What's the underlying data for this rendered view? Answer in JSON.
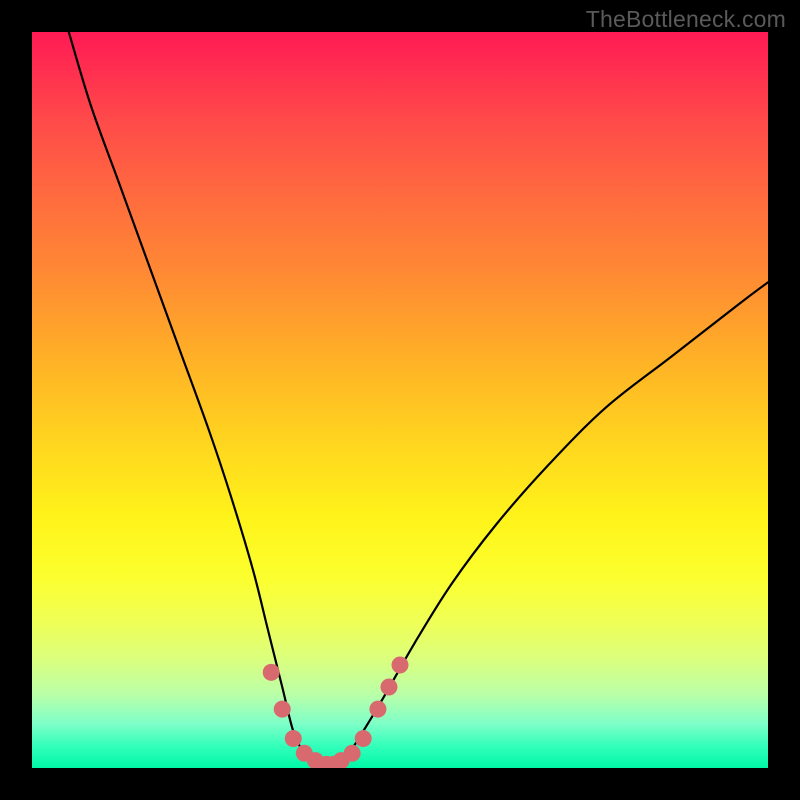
{
  "watermark": "TheBottleneck.com",
  "chart_data": {
    "type": "line",
    "title": "",
    "xlabel": "",
    "ylabel": "",
    "xlim": [
      0,
      100
    ],
    "ylim": [
      0,
      100
    ],
    "series": [
      {
        "name": "curve",
        "x": [
          5,
          8,
          12,
          16,
          20,
          24,
          27,
          30,
          32,
          34,
          35.5,
          37,
          39,
          41,
          43,
          45,
          48,
          52,
          57,
          63,
          70,
          78,
          87,
          96,
          100
        ],
        "values": [
          100,
          90,
          79,
          68,
          57,
          46,
          37,
          27,
          19,
          11,
          5,
          2,
          0.5,
          0.5,
          2,
          5,
          10,
          17,
          25,
          33,
          41,
          49,
          56,
          63,
          66
        ]
      },
      {
        "name": "highlight-dots",
        "x": [
          32.5,
          34,
          35.5,
          37,
          38.5,
          40,
          41,
          42,
          43.5,
          45,
          47,
          48.5,
          50
        ],
        "values": [
          13,
          8,
          4,
          2,
          1,
          0.5,
          0.5,
          1,
          2,
          4,
          8,
          11,
          14
        ]
      }
    ],
    "colors": {
      "curve_stroke": "#000000",
      "dots_fill": "#d86a6f"
    }
  }
}
